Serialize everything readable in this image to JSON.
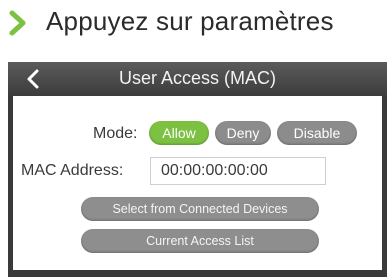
{
  "caption": {
    "text": "Appuyez sur paramètres",
    "chevron_color": "#7cc142"
  },
  "header": {
    "title": "User Access (MAC)",
    "back_icon": "chevron-left-icon"
  },
  "mode": {
    "label": "Mode:",
    "options": [
      "Allow",
      "Deny",
      "Disable"
    ],
    "selected": "Allow",
    "active_color": "#7cc142",
    "inactive_color": "#8c8c8c"
  },
  "mac": {
    "label": "MAC Address:",
    "value": "00:00:00:00:00"
  },
  "buttons": {
    "select_connected": "Select from Connected Devices",
    "current_list": "Current Access List"
  }
}
